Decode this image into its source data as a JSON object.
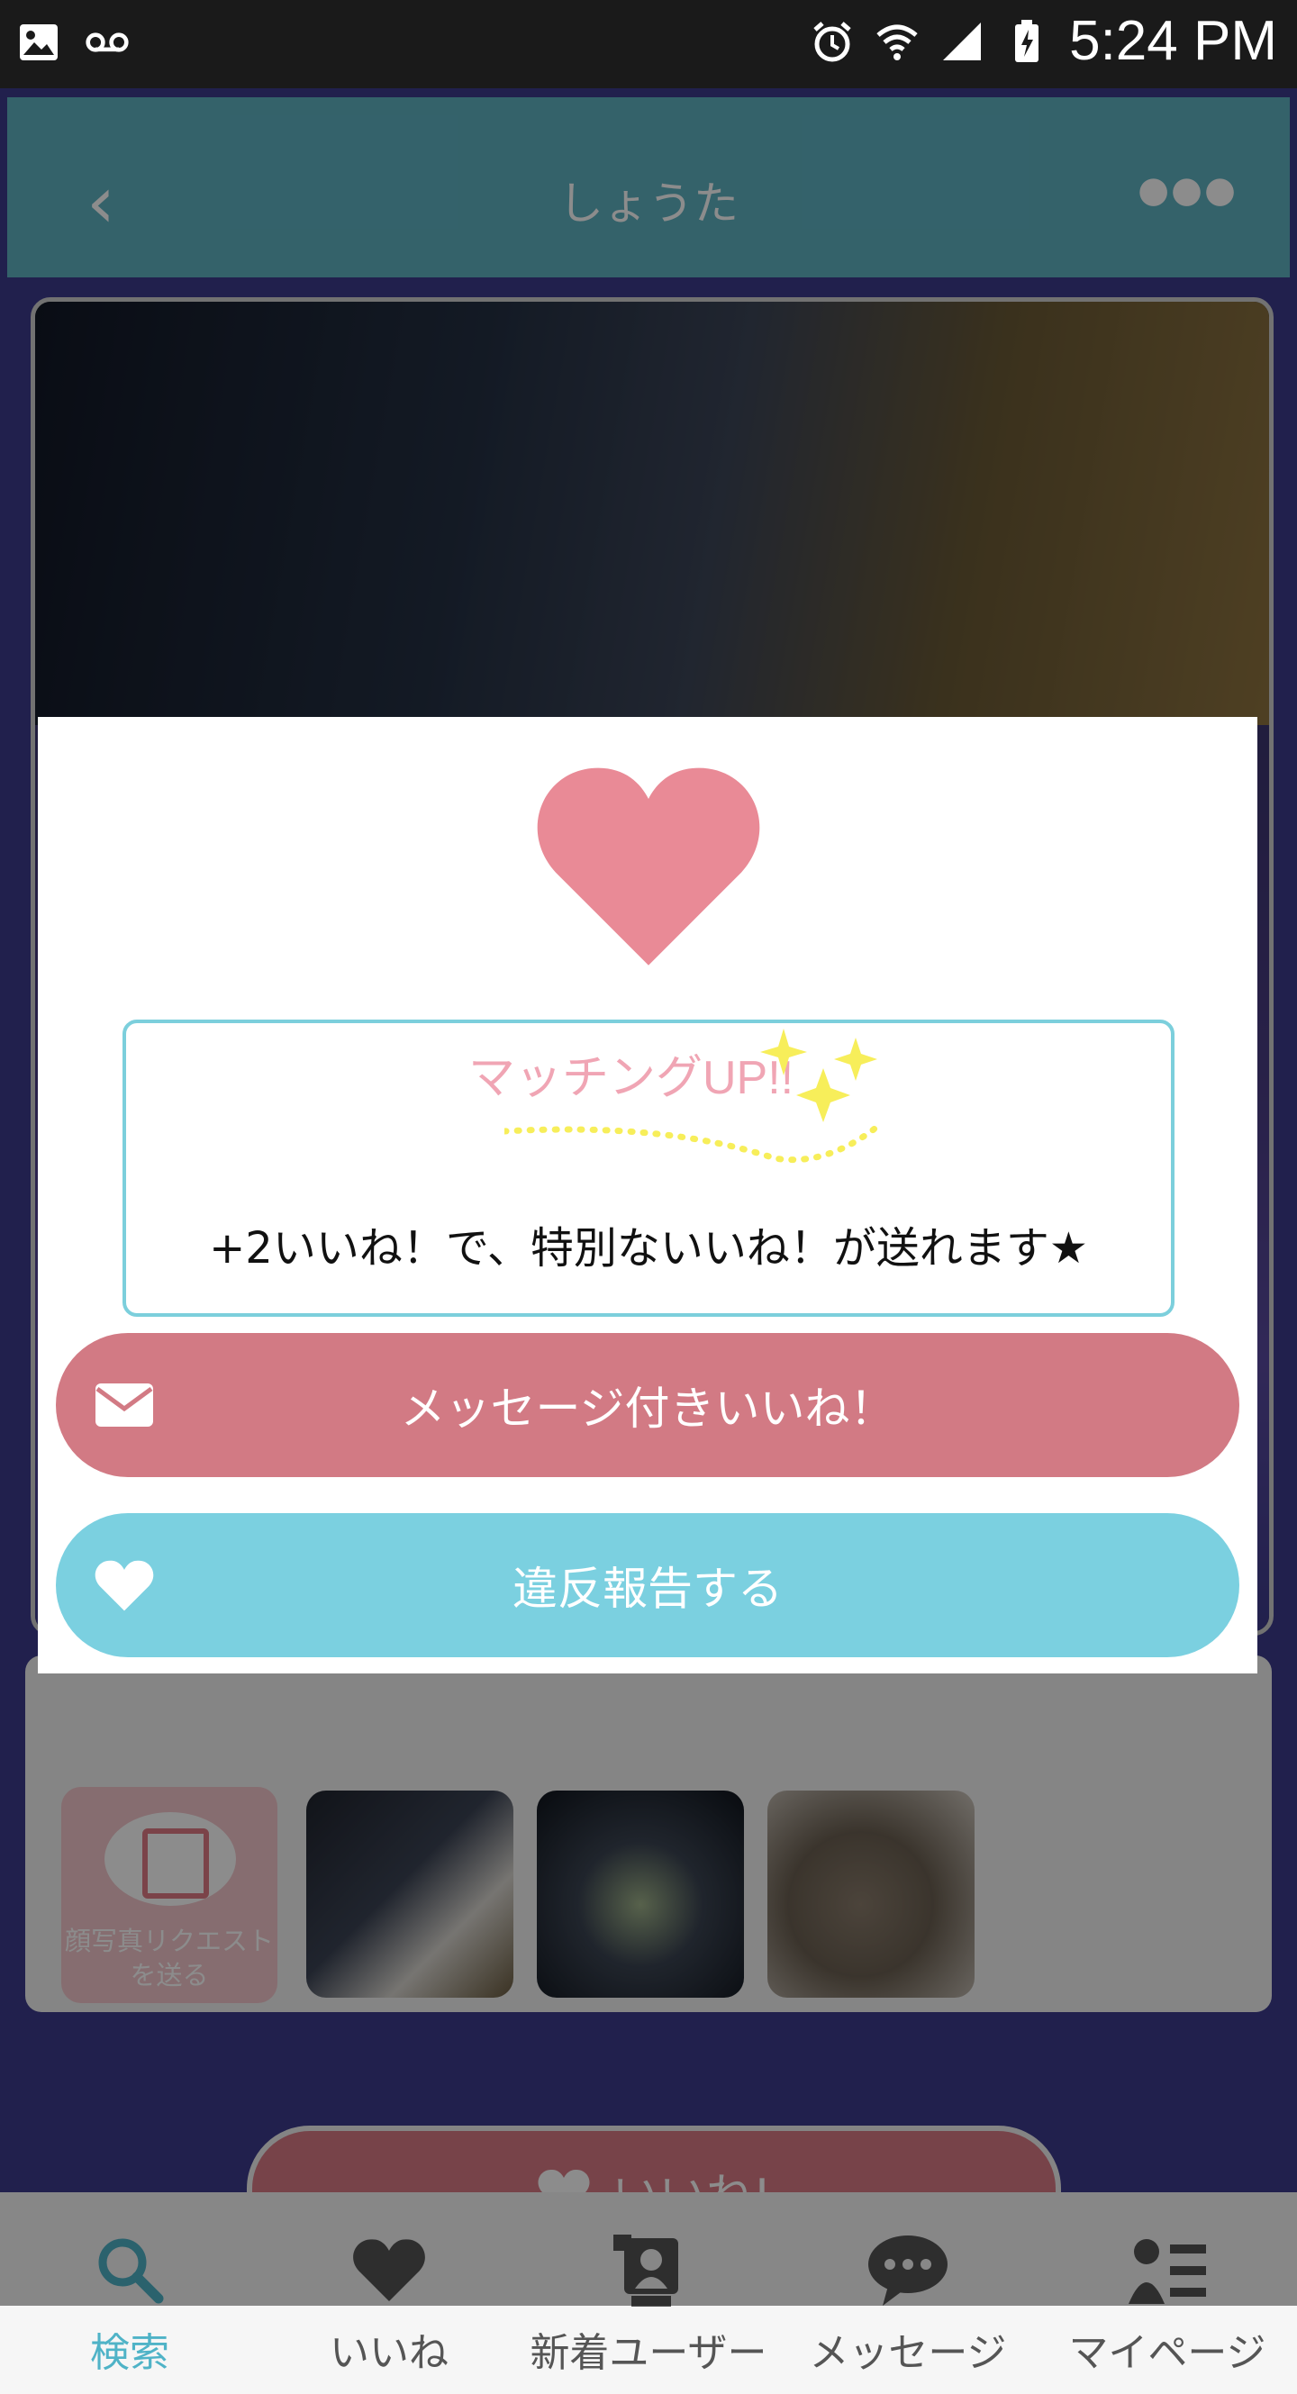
{
  "status_bar": {
    "time": "5:24 PM",
    "left_icons": [
      "image-icon",
      "voicemail-icon"
    ],
    "right_icons": [
      "alarm-icon",
      "wifi-icon",
      "signal-icon",
      "battery-charging-icon"
    ]
  },
  "app_bar": {
    "title": "しょうた",
    "back_icon": "chevron-left-icon",
    "more_icon": "more-horizontal-icon"
  },
  "photos": {
    "request_label": "顔写真リクエスト\nを送る",
    "thumbnails": [
      "photo-1",
      "photo-2",
      "photo-3"
    ]
  },
  "like_button": {
    "label": "いいね!"
  },
  "tabs": [
    {
      "label": "検索",
      "icon": "search-icon",
      "active": true
    },
    {
      "label": "いいね",
      "icon": "heart-icon",
      "active": false
    },
    {
      "label": "新着ユーザー",
      "icon": "new-user-icon",
      "active": false
    },
    {
      "label": "メッセージ",
      "icon": "chat-icon",
      "active": false
    },
    {
      "label": "マイページ",
      "icon": "profile-list-icon",
      "active": false
    }
  ],
  "modal": {
    "promo_logo": "マッチングUP!!",
    "promo_message": "+2いいね！で、特別ないいね！が送れます★",
    "message_like_button": "メッセージ付きいいね！",
    "report_button": "違反報告する",
    "colors": {
      "pink": "#d27a84",
      "blue": "#7bd0e0",
      "heart": "#e98a96"
    }
  }
}
